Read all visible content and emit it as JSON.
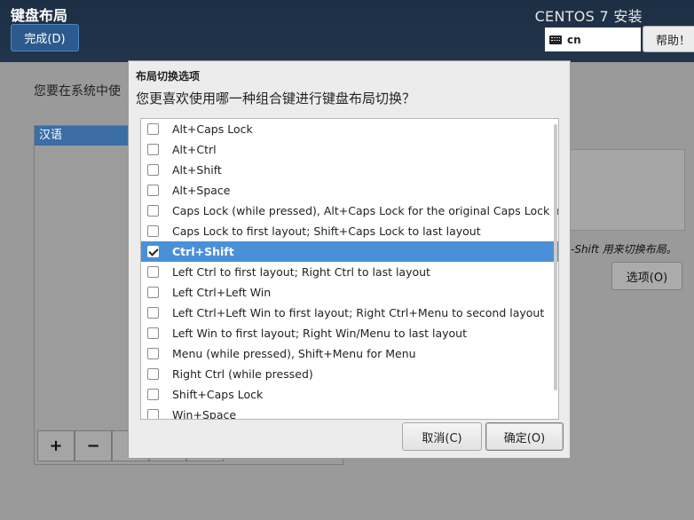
{
  "header": {
    "title": "键盘布局",
    "done_button": "完成(D)",
    "product": "CENTOS 7 安装",
    "keyboard_layout": "cn",
    "help_button": "帮助！"
  },
  "background": {
    "prompt": "您要在系统中使",
    "list_header": "汉语",
    "toolbar": [
      "+",
      "−",
      "",
      "",
      ""
    ],
    "hint": "-Shift 用来切换布局。",
    "options_button": "选项(O)"
  },
  "dialog": {
    "title": "布局切换选项",
    "question": "您更喜欢使用哪一种组合键进行键盘布局切换？",
    "options": [
      {
        "label": "Alt+Caps Lock",
        "checked": false,
        "selected": false
      },
      {
        "label": "Alt+Ctrl",
        "checked": false,
        "selected": false
      },
      {
        "label": "Alt+Shift",
        "checked": false,
        "selected": false
      },
      {
        "label": "Alt+Space",
        "checked": false,
        "selected": false
      },
      {
        "label": "Caps Lock (while pressed), Alt+Caps Lock for the original Caps Lock action",
        "checked": false,
        "selected": false
      },
      {
        "label": "Caps Lock to first layout; Shift+Caps Lock to last layout",
        "checked": false,
        "selected": false
      },
      {
        "label": "Ctrl+Shift",
        "checked": true,
        "selected": true
      },
      {
        "label": "Left Ctrl to first layout; Right Ctrl to last layout",
        "checked": false,
        "selected": false
      },
      {
        "label": "Left Ctrl+Left Win",
        "checked": false,
        "selected": false
      },
      {
        "label": "Left Ctrl+Left Win to first layout; Right Ctrl+Menu to second layout",
        "checked": false,
        "selected": false
      },
      {
        "label": "Left Win to first layout; Right Win/Menu to last layout",
        "checked": false,
        "selected": false
      },
      {
        "label": "Menu (while pressed), Shift+Menu for Menu",
        "checked": false,
        "selected": false
      },
      {
        "label": "Right Ctrl (while pressed)",
        "checked": false,
        "selected": false
      },
      {
        "label": "Shift+Caps Lock",
        "checked": false,
        "selected": false
      },
      {
        "label": "Win+Space",
        "checked": false,
        "selected": false
      }
    ],
    "cancel_button": "取消(C)",
    "ok_button": "确定(O)"
  },
  "colors": {
    "header_bg": "#1f3149",
    "selection": "#4a90d9",
    "overlay_bg": "#9a9a9a",
    "dialog_bg": "#ececec"
  }
}
